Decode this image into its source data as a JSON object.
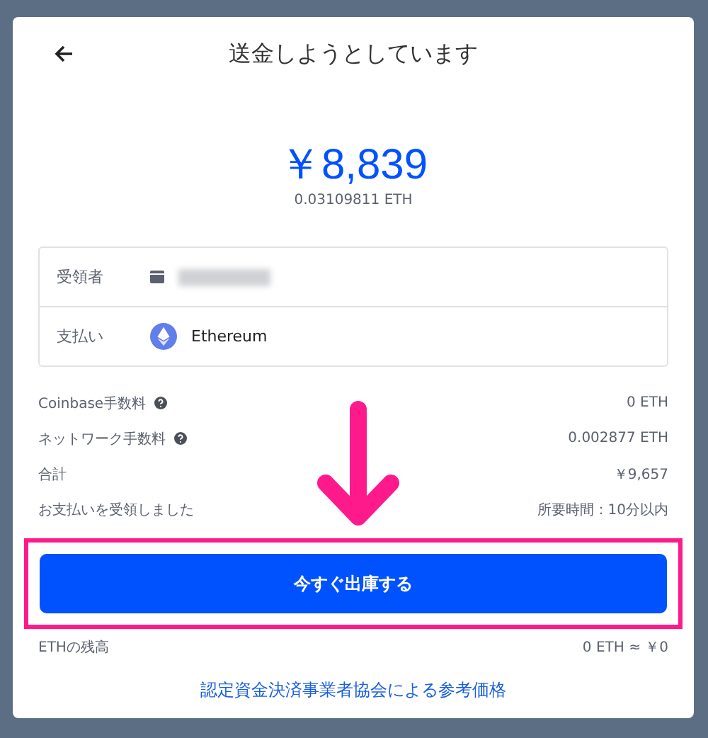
{
  "header": {
    "title": "送金しようとしています"
  },
  "amount": {
    "fiat": "￥8,839",
    "crypto": "0.03109811 ETH"
  },
  "details": [
    {
      "label": "受領者",
      "kind": "wallet"
    },
    {
      "label": "支払い",
      "kind": "coin",
      "value": "Ethereum"
    }
  ],
  "fees": [
    {
      "label": "Coinbase手数料",
      "help": true,
      "value": "0 ETH"
    },
    {
      "label": "ネットワーク手数料",
      "help": true,
      "value": "0.002877 ETH"
    },
    {
      "label": "合計",
      "help": false,
      "value": "￥9,657"
    },
    {
      "label": "お支払いを受領しました",
      "help": false,
      "value": "所要時間：10分以内"
    }
  ],
  "confirm_button": {
    "label": "今すぐ出庫する",
    "highlighted": true
  },
  "balance": {
    "label": "ETHの残高",
    "value": "0 ETH ≈ ￥0"
  },
  "reference_link": "認定資金決済事業者協会による参考価格"
}
